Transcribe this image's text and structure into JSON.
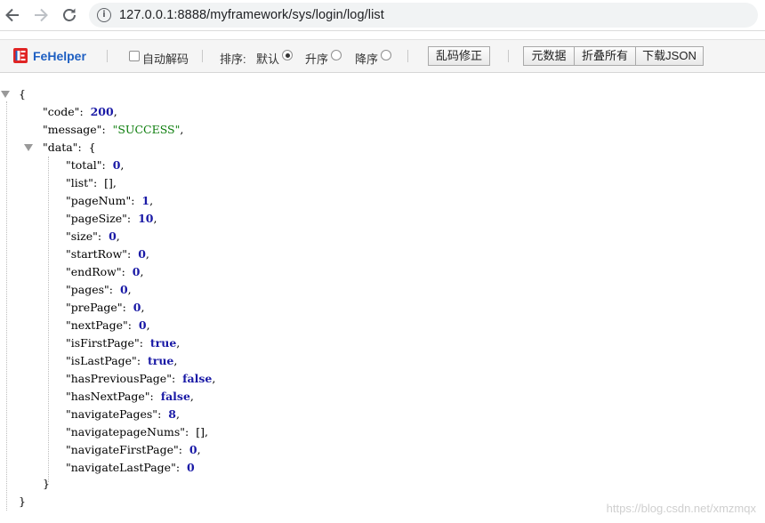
{
  "browser": {
    "url": "127.0.0.1:8888/myframework/sys/login/log/list"
  },
  "fehelper": {
    "name": "FeHelper",
    "auto_decode_label": "自动解码",
    "sort_label": "排序:",
    "sort_default": "默认",
    "sort_asc": "升序",
    "sort_desc": "降序",
    "sort_selected": "默认",
    "fix_encoding_button": "乱码修正",
    "raw_button": "元数据",
    "collapse_button": "折叠所有",
    "download_button": "下载JSON"
  },
  "json": {
    "open_brace": "{",
    "close_brace": "}",
    "code_key": "\"code\"",
    "code_value": "200",
    "message_key": "\"message\"",
    "message_value": "\"SUCCESS\"",
    "data_key": "\"data\"",
    "data_open": "{",
    "data_close": "}",
    "data_fields": [
      {
        "key": "\"total\"",
        "value": "0",
        "type": "n",
        "comma": ","
      },
      {
        "key": "\"list\"",
        "value": "[]",
        "type": "p",
        "comma": ","
      },
      {
        "key": "\"pageNum\"",
        "value": "1",
        "type": "n",
        "comma": ","
      },
      {
        "key": "\"pageSize\"",
        "value": "10",
        "type": "n",
        "comma": ","
      },
      {
        "key": "\"size\"",
        "value": "0",
        "type": "n",
        "comma": ","
      },
      {
        "key": "\"startRow\"",
        "value": "0",
        "type": "n",
        "comma": ","
      },
      {
        "key": "\"endRow\"",
        "value": "0",
        "type": "n",
        "comma": ","
      },
      {
        "key": "\"pages\"",
        "value": "0",
        "type": "n",
        "comma": ","
      },
      {
        "key": "\"prePage\"",
        "value": "0",
        "type": "n",
        "comma": ","
      },
      {
        "key": "\"nextPage\"",
        "value": "0",
        "type": "n",
        "comma": ","
      },
      {
        "key": "\"isFirstPage\"",
        "value": "true",
        "type": "b",
        "comma": ","
      },
      {
        "key": "\"isLastPage\"",
        "value": "true",
        "type": "b",
        "comma": ","
      },
      {
        "key": "\"hasPreviousPage\"",
        "value": "false",
        "type": "b",
        "comma": ","
      },
      {
        "key": "\"hasNextPage\"",
        "value": "false",
        "type": "b",
        "comma": ","
      },
      {
        "key": "\"navigatePages\"",
        "value": "8",
        "type": "n",
        "comma": ","
      },
      {
        "key": "\"navigatepageNums\"",
        "value": "[]",
        "type": "p",
        "comma": ","
      },
      {
        "key": "\"navigateFirstPage\"",
        "value": "0",
        "type": "n",
        "comma": ","
      },
      {
        "key": "\"navigateLastPage\"",
        "value": "0",
        "type": "n",
        "comma": ""
      }
    ]
  },
  "watermark": "https://blog.csdn.net/xmzmqx"
}
